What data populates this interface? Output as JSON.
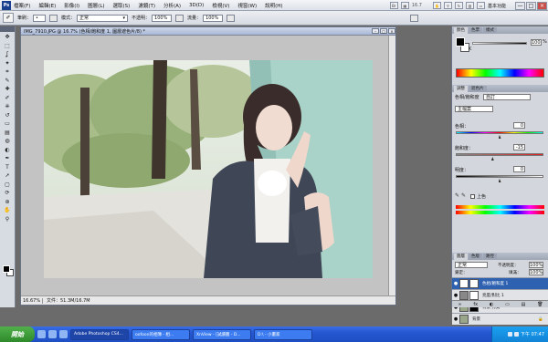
{
  "app": {
    "logo": "Ps",
    "menu": [
      "檔案(F)",
      "編輯(E)",
      "影像(I)",
      "圖層(L)",
      "選取(S)",
      "濾鏡(T)",
      "分析(A)",
      "3D(D)",
      "檢視(V)",
      "視窗(W)",
      "說明(H)"
    ],
    "zoom_level": "16.7",
    "workspace": "基本功能",
    "window_buttons": [
      "—",
      "□",
      "×"
    ]
  },
  "options": {
    "brush_label": "筆刷：",
    "brush_size": "•",
    "mode_label": "模式：",
    "mode_value": "正常",
    "opacity_label": "不透明：",
    "opacity_value": "100%",
    "flow_label": "流量：",
    "flow_value": "100%"
  },
  "document": {
    "title": "IMG_7910.JPG @ 16.7% (色相/飽和度 1, 圖層遮色片/8) *",
    "zoom": "16.67%",
    "info": "文件：51.3M/16.7M"
  },
  "tools": {
    "icons": [
      "move-icon",
      "marquee-icon",
      "lasso-icon",
      "magic-wand-icon",
      "crop-icon",
      "eyedropper-icon",
      "healing-icon",
      "brush-icon",
      "stamp-icon",
      "history-brush-icon",
      "eraser-icon",
      "gradient-icon",
      "blur-icon",
      "dodge-icon",
      "pen-icon",
      "type-icon",
      "path-select-icon",
      "shape-icon",
      "3d-rotate-icon",
      "3d-orbit-icon",
      "hand-icon",
      "zoom-icon"
    ],
    "glyphs": [
      "✥",
      "⬚",
      "ʆ",
      "✦",
      "⌗",
      "✎",
      "✚",
      "✐",
      "⎈",
      "↺",
      "▭",
      "▤",
      "◍",
      "◐",
      "✒",
      "T",
      "➚",
      "▢",
      "⟳",
      "⊛",
      "✋",
      "⚲"
    ]
  },
  "color_panel": {
    "tabs": [
      "顏色",
      "色票",
      "樣式"
    ],
    "channel": "K",
    "value": "100",
    "unit": "%"
  },
  "adjustments_panel": {
    "tabs": [
      "調整",
      "遮色片"
    ],
    "title": "色相/飽和度",
    "preset": "自訂",
    "edit": "主檔案",
    "sliders": [
      {
        "label": "色相：",
        "value": "0",
        "pos": 0.5
      },
      {
        "label": "飽和度：",
        "value": "-15",
        "pos": 0.42
      },
      {
        "label": "明度：",
        "value": "0",
        "pos": 0.5
      }
    ],
    "colorize_label": "上色"
  },
  "layers_panel": {
    "tabs": [
      "圖層",
      "色版",
      "路徑"
    ],
    "blend_mode": "正常",
    "opacity_label": "不透明度：",
    "opacity_value": "100%",
    "lock_label": "鎖定：",
    "fill_label": "填滿：",
    "fill_value": "100%",
    "layers": [
      {
        "name": "色相/飽和度 1",
        "selected": true
      },
      {
        "name": "亮度/對比 1",
        "selected": false
      },
      {
        "name": "背景 拷貝",
        "selected": false
      },
      {
        "name": "背景",
        "selected": false
      }
    ],
    "footer_icons": [
      "∞",
      "fx",
      "◐",
      "▭",
      "▤",
      "🗑"
    ]
  },
  "taskbar": {
    "start_label": "開始",
    "tasks": [
      "Adobe Photoshop CS4...",
      "oofoon的相簿 - 相...",
      "XnView - [試讀圖 - D...",
      "D:\\ - 小畫家"
    ],
    "clock": "下午 07:47"
  }
}
